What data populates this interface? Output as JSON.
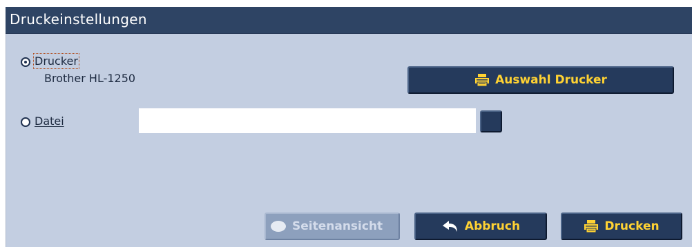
{
  "dialog": {
    "title": "Druckeinstellungen"
  },
  "output": {
    "printer_option_label": "Drucker",
    "printer_option_selected": true,
    "printer_name": "Brother HL-1250",
    "file_option_label": "Datei",
    "file_option_selected": false,
    "file_path_value": "",
    "select_printer_label": "Auswahl Drucker"
  },
  "footer": {
    "preview_label": "Seitenansicht",
    "preview_enabled": false,
    "cancel_label": "Abbruch",
    "print_label": "Drucken"
  },
  "icons": {
    "printer": "printer-icon",
    "undo": "undo-arrow-icon",
    "preview": "preview-icon"
  },
  "colors": {
    "accent_text": "#ffd233",
    "button_bg": "#253a5c",
    "titlebar_bg": "#2e4464",
    "panel_bg": "#c3cee1"
  }
}
